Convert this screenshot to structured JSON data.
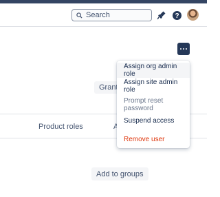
{
  "header": {
    "search_placeholder": "Search",
    "icons": [
      "search-icon",
      "notifications-icon",
      "help-icon",
      "avatar"
    ]
  },
  "page": {
    "grant_button_label": "Grant a",
    "table_columns": [
      "Product roles",
      "A"
    ],
    "add_to_groups_label": "Add to groups"
  },
  "actions_menu": {
    "items": [
      {
        "label": "Assign org admin role",
        "state": "hover"
      },
      {
        "label": "Assign site admin role",
        "state": "normal"
      },
      {
        "label": "Prompt reset password",
        "state": "disabled"
      },
      {
        "label": "Suspend access",
        "state": "normal"
      },
      {
        "label": "Remove user",
        "state": "danger"
      }
    ]
  },
  "colors": {
    "topbar": "#344563",
    "more_button": "#253858",
    "danger": "#DE350B",
    "text": "#172B4D"
  }
}
